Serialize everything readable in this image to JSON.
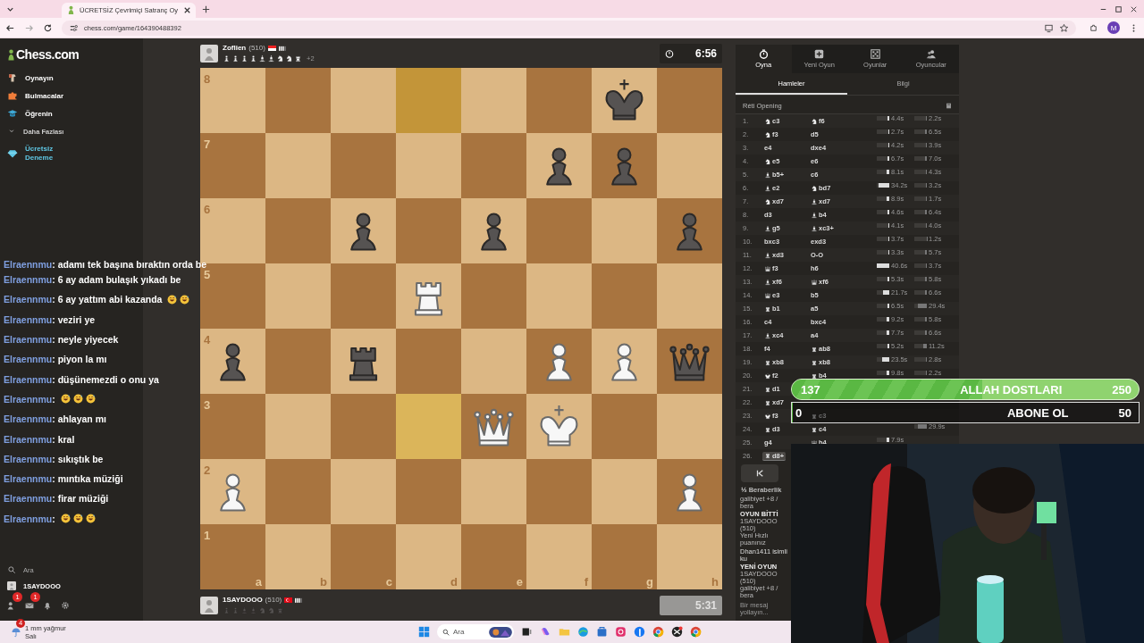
{
  "browser": {
    "tab_title": "ÜCRETSİZ Çevrimiçi Satranç Oy",
    "url": "chess.com/game/164390488392",
    "profile_initial": "M"
  },
  "sidebar": {
    "logo": "Chess.com",
    "items": [
      {
        "label": "Oynayın",
        "kind": "play"
      },
      {
        "label": "Bulmacalar",
        "kind": "puzzle"
      },
      {
        "label": "Öğrenin",
        "kind": "learn"
      },
      {
        "label": "Daha Fazlası",
        "kind": "more"
      },
      {
        "label": "Ücretsiz Deneme",
        "kind": "trial"
      }
    ],
    "search": "Ara",
    "user": "1SAYDOOO",
    "icons": [
      {
        "kind": "friends",
        "badge": "1"
      },
      {
        "kind": "mail",
        "badge": "1"
      },
      {
        "kind": "bell"
      },
      {
        "kind": "settings"
      }
    ]
  },
  "top_player": {
    "name": "Zoflien",
    "rating": "(510)",
    "flag": {
      "kind": "indonesia"
    },
    "captured": [
      {
        "kind": "white-pawn"
      },
      {
        "kind": "white-pawn"
      },
      {
        "kind": "white-pawn"
      },
      {
        "kind": "white-pawn"
      },
      {
        "kind": "white-bishop"
      },
      {
        "kind": "white-bishop"
      },
      {
        "kind": "white-knight"
      },
      {
        "kind": "white-knight"
      },
      {
        "kind": "white-rook"
      }
    ],
    "advantage": "+2",
    "clock": "6:56",
    "running": true
  },
  "board": {
    "files": [
      "a",
      "b",
      "c",
      "d",
      "e",
      "f",
      "g",
      "h"
    ],
    "ranks": [
      {
        "label": "8",
        "squares": [
          {
            "kind": "empty",
            "highlighted": false
          },
          {
            "kind": "empty",
            "highlighted": false
          },
          {
            "kind": "empty",
            "highlighted": false
          },
          {
            "kind": "empty",
            "highlighted": true
          },
          {
            "kind": "empty",
            "highlighted": false
          },
          {
            "kind": "empty",
            "highlighted": false
          },
          {
            "kind": "black-king",
            "highlighted": false
          },
          {
            "kind": "empty",
            "highlighted": false
          }
        ]
      },
      {
        "label": "7",
        "squares": [
          {
            "kind": "empty",
            "highlighted": false
          },
          {
            "kind": "empty",
            "highlighted": false
          },
          {
            "kind": "empty",
            "highlighted": false
          },
          {
            "kind": "empty",
            "highlighted": false
          },
          {
            "kind": "empty",
            "highlighted": false
          },
          {
            "kind": "black-pawn",
            "highlighted": false
          },
          {
            "kind": "black-pawn",
            "highlighted": false
          },
          {
            "kind": "empty",
            "highlighted": false
          }
        ]
      },
      {
        "label": "6",
        "squares": [
          {
            "kind": "empty",
            "highlighted": false
          },
          {
            "kind": "empty",
            "highlighted": false
          },
          {
            "kind": "black-pawn",
            "highlighted": false
          },
          {
            "kind": "empty",
            "highlighted": false
          },
          {
            "kind": "black-pawn",
            "highlighted": false
          },
          {
            "kind": "empty",
            "highlighted": false
          },
          {
            "kind": "empty",
            "highlighted": false
          },
          {
            "kind": "black-pawn",
            "highlighted": false
          }
        ]
      },
      {
        "label": "5",
        "squares": [
          {
            "kind": "empty",
            "highlighted": false
          },
          {
            "kind": "empty",
            "highlighted": false
          },
          {
            "kind": "empty",
            "highlighted": false
          },
          {
            "kind": "white-rook",
            "highlighted": false
          },
          {
            "kind": "empty",
            "highlighted": false
          },
          {
            "kind": "empty",
            "highlighted": false
          },
          {
            "kind": "empty",
            "highlighted": false
          },
          {
            "kind": "empty",
            "highlighted": false
          }
        ]
      },
      {
        "label": "4",
        "squares": [
          {
            "kind": "black-pawn",
            "highlighted": false
          },
          {
            "kind": "empty",
            "highlighted": false
          },
          {
            "kind": "black-rook",
            "highlighted": false
          },
          {
            "kind": "empty",
            "highlighted": false
          },
          {
            "kind": "empty",
            "highlighted": false
          },
          {
            "kind": "white-pawn",
            "highlighted": false
          },
          {
            "kind": "white-pawn",
            "highlighted": false
          },
          {
            "kind": "black-queen",
            "highlighted": false
          }
        ]
      },
      {
        "label": "3",
        "squares": [
          {
            "kind": "empty",
            "highlighted": false
          },
          {
            "kind": "empty",
            "highlighted": false
          },
          {
            "kind": "empty",
            "highlighted": false
          },
          {
            "kind": "empty",
            "highlighted": true
          },
          {
            "kind": "white-queen",
            "highlighted": false
          },
          {
            "kind": "white-king",
            "highlighted": false
          },
          {
            "kind": "empty",
            "highlighted": false
          },
          {
            "kind": "empty",
            "highlighted": false
          }
        ]
      },
      {
        "label": "2",
        "squares": [
          {
            "kind": "white-pawn",
            "highlighted": false
          },
          {
            "kind": "empty",
            "highlighted": false
          },
          {
            "kind": "empty",
            "highlighted": false
          },
          {
            "kind": "empty",
            "highlighted": false
          },
          {
            "kind": "empty",
            "highlighted": false
          },
          {
            "kind": "empty",
            "highlighted": false
          },
          {
            "kind": "empty",
            "highlighted": false
          },
          {
            "kind": "white-pawn",
            "highlighted": false
          }
        ]
      },
      {
        "label": "1",
        "squares": [
          {
            "kind": "empty",
            "highlighted": false
          },
          {
            "kind": "empty",
            "highlighted": false
          },
          {
            "kind": "empty",
            "highlighted": false
          },
          {
            "kind": "empty",
            "highlighted": false
          },
          {
            "kind": "empty",
            "highlighted": false
          },
          {
            "kind": "empty",
            "highlighted": false
          },
          {
            "kind": "empty",
            "highlighted": false
          },
          {
            "kind": "empty",
            "highlighted": false
          }
        ]
      }
    ]
  },
  "bottom_player": {
    "name": "1SAYDOOO",
    "rating": "(510)",
    "flag": {
      "kind": "turkey"
    },
    "captured": [
      {
        "kind": "black-pawn"
      },
      {
        "kind": "black-pawn"
      },
      {
        "kind": "black-bishop"
      },
      {
        "kind": "black-bishop"
      },
      {
        "kind": "black-knight"
      },
      {
        "kind": "black-knight"
      },
      {
        "kind": "black-rook"
      }
    ],
    "clock": "5:31",
    "running": false
  },
  "panel": {
    "tabs": [
      {
        "label": "Oyna",
        "kind": "play",
        "selected": true
      },
      {
        "label": "Yeni Oyun",
        "kind": "new",
        "selected": false
      },
      {
        "label": "Oyunlar",
        "kind": "games",
        "selected": false
      },
      {
        "label": "Oyuncular",
        "kind": "players",
        "selected": false
      }
    ],
    "subtabs": [
      {
        "label": "Hamleler",
        "selected": true
      },
      {
        "label": "Bilgi",
        "selected": false
      }
    ],
    "opening": "Réti Opening",
    "moves": [
      {
        "number": "1.",
        "white": {
          "kind": "knight",
          "san": "c3",
          "selected": false
        },
        "black": {
          "kind": "knight",
          "san": "f6",
          "selected": false
        },
        "white_time": {
          "text": "4.4s",
          "level": 0.11
        },
        "black_time": {
          "text": "2.2s",
          "level": 0.05
        }
      },
      {
        "number": "2.",
        "white": {
          "kind": "knight",
          "san": "f3",
          "selected": false
        },
        "black": {
          "san": "d5",
          "selected": false
        },
        "white_time": {
          "text": "2.7s",
          "level": 0.07
        },
        "black_time": {
          "text": "6.5s",
          "level": 0.16
        }
      },
      {
        "number": "3.",
        "white": {
          "san": "e4",
          "selected": false
        },
        "black": {
          "san": "dxe4",
          "selected": false
        },
        "white_time": {
          "text": "4.2s",
          "level": 0.1
        },
        "black_time": {
          "text": "3.9s",
          "level": 0.1
        }
      },
      {
        "number": "4.",
        "white": {
          "kind": "knight",
          "san": "e5",
          "selected": false
        },
        "black": {
          "san": "e6",
          "selected": false
        },
        "white_time": {
          "text": "6.7s",
          "level": 0.16
        },
        "black_time": {
          "text": "7.0s",
          "level": 0.17
        }
      },
      {
        "number": "5.",
        "white": {
          "kind": "bishop",
          "san": "b5+",
          "selected": false
        },
        "black": {
          "san": "c6",
          "selected": false
        },
        "white_time": {
          "text": "8.1s",
          "level": 0.2
        },
        "black_time": {
          "text": "4.3s",
          "level": 0.1
        }
      },
      {
        "number": "6.",
        "white": {
          "kind": "bishop",
          "san": "e2",
          "selected": false
        },
        "black": {
          "kind": "knight",
          "san": "bd7",
          "selected": false
        },
        "white_time": {
          "text": "34.2s",
          "level": 0.84
        },
        "black_time": {
          "text": "3.2s",
          "level": 0.08
        }
      },
      {
        "number": "7.",
        "white": {
          "kind": "knight",
          "san": "xd7",
          "selected": false
        },
        "black": {
          "kind": "bishop",
          "san": "xd7",
          "selected": false
        },
        "white_time": {
          "text": "8.9s",
          "level": 0.22
        },
        "black_time": {
          "text": "1.7s",
          "level": 0.04
        }
      },
      {
        "number": "8.",
        "white": {
          "san": "d3",
          "selected": false
        },
        "black": {
          "kind": "bishop",
          "san": "b4",
          "selected": false
        },
        "white_time": {
          "text": "4.6s",
          "level": 0.11
        },
        "black_time": {
          "text": "6.4s",
          "level": 0.16
        }
      },
      {
        "number": "9.",
        "white": {
          "kind": "bishop",
          "san": "g5",
          "selected": false
        },
        "black": {
          "kind": "bishop",
          "san": "xc3+",
          "selected": false
        },
        "white_time": {
          "text": "4.1s",
          "level": 0.1
        },
        "black_time": {
          "text": "4.0s",
          "level": 0.1
        }
      },
      {
        "number": "10.",
        "white": {
          "san": "bxc3",
          "selected": false
        },
        "black": {
          "san": "exd3",
          "selected": false
        },
        "white_time": {
          "text": "3.7s",
          "level": 0.09
        },
        "black_time": {
          "text": "1.2s",
          "level": 0.03
        }
      },
      {
        "number": "11.",
        "white": {
          "kind": "bishop",
          "san": "xd3",
          "selected": false
        },
        "black": {
          "san": "O-O",
          "selected": false
        },
        "white_time": {
          "text": "3.3s",
          "level": 0.08
        },
        "black_time": {
          "text": "5.7s",
          "level": 0.14
        }
      },
      {
        "number": "12.",
        "white": {
          "kind": "queen",
          "san": "f3",
          "selected": false
        },
        "black": {
          "san": "h6",
          "selected": false
        },
        "white_time": {
          "text": "40.6s",
          "level": 1
        },
        "black_time": {
          "text": "3.7s",
          "level": 0.09
        }
      },
      {
        "number": "13.",
        "white": {
          "kind": "bishop",
          "san": "xf6",
          "selected": false
        },
        "black": {
          "kind": "queen",
          "san": "xf6",
          "selected": false
        },
        "white_time": {
          "text": "5.3s",
          "level": 0.13
        },
        "black_time": {
          "text": "5.8s",
          "level": 0.14
        }
      },
      {
        "number": "14.",
        "white": {
          "kind": "queen",
          "san": "e3",
          "selected": false
        },
        "black": {
          "san": "b5",
          "selected": false
        },
        "white_time": {
          "text": "21.7s",
          "level": 0.53
        },
        "black_time": {
          "text": "6.6s",
          "level": 0.16
        }
      },
      {
        "number": "15.",
        "white": {
          "kind": "rook",
          "san": "b1",
          "selected": false
        },
        "black": {
          "san": "a5",
          "selected": false
        },
        "white_time": {
          "text": "6.5s",
          "level": 0.16
        },
        "black_time": {
          "text": "29.4s",
          "level": 0.72
        }
      },
      {
        "number": "16.",
        "white": {
          "san": "c4",
          "selected": false
        },
        "black": {
          "san": "bxc4",
          "selected": false
        },
        "white_time": {
          "text": "9.2s",
          "level": 0.23
        },
        "black_time": {
          "text": "5.8s",
          "level": 0.14
        }
      },
      {
        "number": "17.",
        "white": {
          "kind": "bishop",
          "san": "xc4",
          "selected": false
        },
        "black": {
          "san": "a4",
          "selected": false
        },
        "white_time": {
          "text": "7.7s",
          "level": 0.19
        },
        "black_time": {
          "text": "6.6s",
          "level": 0.16
        }
      },
      {
        "number": "18.",
        "white": {
          "san": "f4",
          "selected": false
        },
        "black": {
          "kind": "rook",
          "san": "ab8",
          "selected": false
        },
        "white_time": {
          "text": "5.2s",
          "level": 0.13
        },
        "black_time": {
          "text": "11.2s",
          "level": 0.28
        }
      },
      {
        "number": "19.",
        "white": {
          "kind": "rook",
          "san": "xb8",
          "selected": false
        },
        "black": {
          "kind": "rook",
          "san": "xb8",
          "selected": false
        },
        "white_time": {
          "text": "23.5s",
          "level": 0.58
        },
        "black_time": {
          "text": "2.8s",
          "level": 0.07
        }
      },
      {
        "number": "20.",
        "white": {
          "kind": "king",
          "san": "f2",
          "selected": false
        },
        "black": {
          "kind": "rook",
          "san": "b4",
          "selected": false
        },
        "white_time": {
          "text": "9.8s",
          "level": 0.24
        },
        "black_time": {
          "text": "2.2s",
          "level": 0.05
        }
      },
      {
        "number": "21.",
        "white": {
          "kind": "rook",
          "san": "d1",
          "selected": false
        }
      },
      {
        "number": "22.",
        "white": {
          "kind": "rook",
          "san": "xd7",
          "selected": false
        }
      },
      {
        "number": "23.",
        "white": {
          "kind": "king",
          "san": "f3",
          "selected": false
        },
        "black": {
          "kind": "rook",
          "san": "c3",
          "selected": false
        }
      },
      {
        "number": "24.",
        "white": {
          "kind": "rook",
          "san": "d3",
          "selected": false
        },
        "black": {
          "kind": "rook",
          "san": "c4",
          "selected": false
        },
        "black_time": {
          "text": "29.9s",
          "level": 0.74
        }
      },
      {
        "number": "25.",
        "white": {
          "san": "g4",
          "selected": false
        },
        "black": {
          "kind": "queen",
          "san": "h4",
          "selected": false
        },
        "white_time": {
          "text": "7.9s",
          "level": 0.19
        }
      },
      {
        "number": "26.",
        "white": {
          "kind": "rook",
          "san": "d8+",
          "selected": true
        }
      }
    ],
    "draw": {
      "symbol": "½",
      "label": "Beraberlik"
    },
    "messages": [
      {
        "kind": "plain",
        "text": "galibiyet +8 / bera"
      },
      {
        "kind": "heading",
        "text": "OYUN BİTTİ"
      },
      {
        "kind": "plain",
        "text": "1SAYDOOO (510)"
      },
      {
        "kind": "plain",
        "text": "Yeni Hızlı puanınız"
      },
      {
        "kind": "notice",
        "text": "Dhan1411 isimli ku"
      },
      {
        "kind": "heading",
        "text": "YENİ OYUN"
      },
      {
        "kind": "plain",
        "text": "1SAYDOOO (510)"
      },
      {
        "kind": "plain",
        "text": "galibiyet +8 / bera"
      }
    ],
    "placeholder": "Bir mesaj yollayın..."
  },
  "chat": [
    {
      "user": "Elraennmu",
      "text": ": adamı tek başına bıraktın orda be"
    },
    {
      "user": "Elraennmu",
      "text": ": 6 ay adam bulaşık yıkadı be"
    },
    {
      "user": "Elraennmu",
      "text": ": 6 ay yattım abi kazanda",
      "emojis": [
        {
          "kind": "laugh"
        },
        {
          "kind": "laugh"
        }
      ]
    },
    {
      "user": "Elraennmu",
      "text": ": veziri ye"
    },
    {
      "user": "Elraennmu",
      "text": ": neyle yiyecek"
    },
    {
      "user": "Elraennmu",
      "text": ": piyon la mı"
    },
    {
      "user": "Elraennmu",
      "text": ": düşünemezdi o onu ya"
    },
    {
      "user": "Elraennmu",
      "text": ":",
      "emojis": [
        {
          "kind": "laugh"
        },
        {
          "kind": "laugh"
        },
        {
          "kind": "laugh"
        }
      ]
    },
    {
      "user": "Elraennmu",
      "text": ": ahlayan mı"
    },
    {
      "user": "Elraennmu",
      "text": ": kral"
    },
    {
      "user": "Elraennmu",
      "text": ": sıkıştık be"
    },
    {
      "user": "Elraennmu",
      "text": ": mıntıka müziği"
    },
    {
      "user": "Elraennmu",
      "text": ": firar müziği"
    },
    {
      "user": "Elraennmu",
      "text": ":",
      "emojis": [
        {
          "kind": "laugh"
        },
        {
          "kind": "laugh"
        },
        {
          "kind": "laugh"
        }
      ]
    }
  ],
  "alerts": [
    {
      "kind": "follower",
      "count": "137",
      "label": "ALLAH DOSTLARI",
      "goal": "250",
      "level": 0.55
    },
    {
      "kind": "subscriber",
      "count": "0",
      "label": "ABONE OL",
      "goal": "50",
      "level": 0
    }
  ],
  "taskbar": {
    "weather_badge": "4",
    "weather": "1 mm yağmur",
    "day": "Salı",
    "search": "Ara"
  }
}
